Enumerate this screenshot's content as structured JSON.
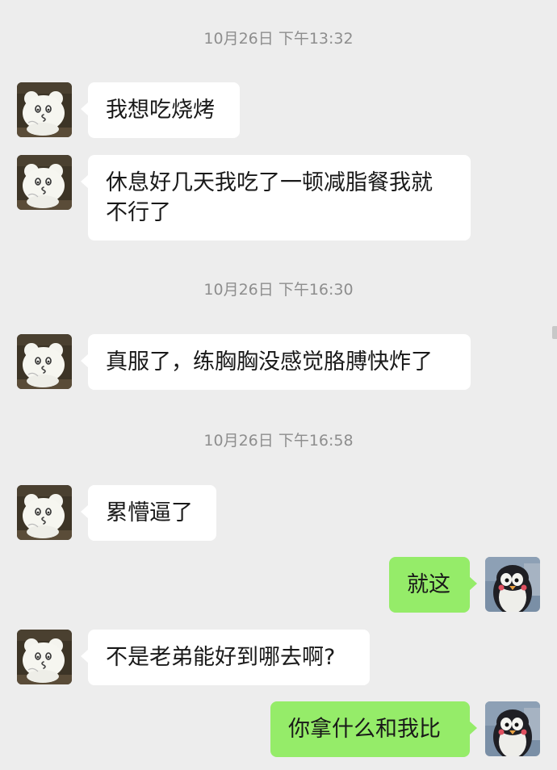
{
  "colors": {
    "background": "#ededed",
    "incoming_bubble": "#ffffff",
    "outgoing_bubble": "#95ec69",
    "timestamp_text": "#8e8e8e",
    "message_text": "#191919"
  },
  "contact": {
    "avatar_icon": "cartoon-bear-avatar-icon"
  },
  "me": {
    "avatar_icon": "penguin-avatar-icon"
  },
  "timestamps": [
    "10月26日 下午13:32",
    "10月26日 下午16:30",
    "10月26日 下午16:58"
  ],
  "messages": [
    {
      "from": "contact",
      "text": "我想吃烧烤"
    },
    {
      "from": "contact",
      "text": "休息好几天我吃了一顿减脂餐我就不行了"
    },
    {
      "from": "contact",
      "text": "真服了，练胸胸没感觉胳膊快炸了"
    },
    {
      "from": "contact",
      "text": "累懵逼了"
    },
    {
      "from": "me",
      "text": "就这"
    },
    {
      "from": "contact",
      "text": "不是老弟能好到哪去啊?"
    },
    {
      "from": "me",
      "text": "你拿什么和我比"
    }
  ]
}
